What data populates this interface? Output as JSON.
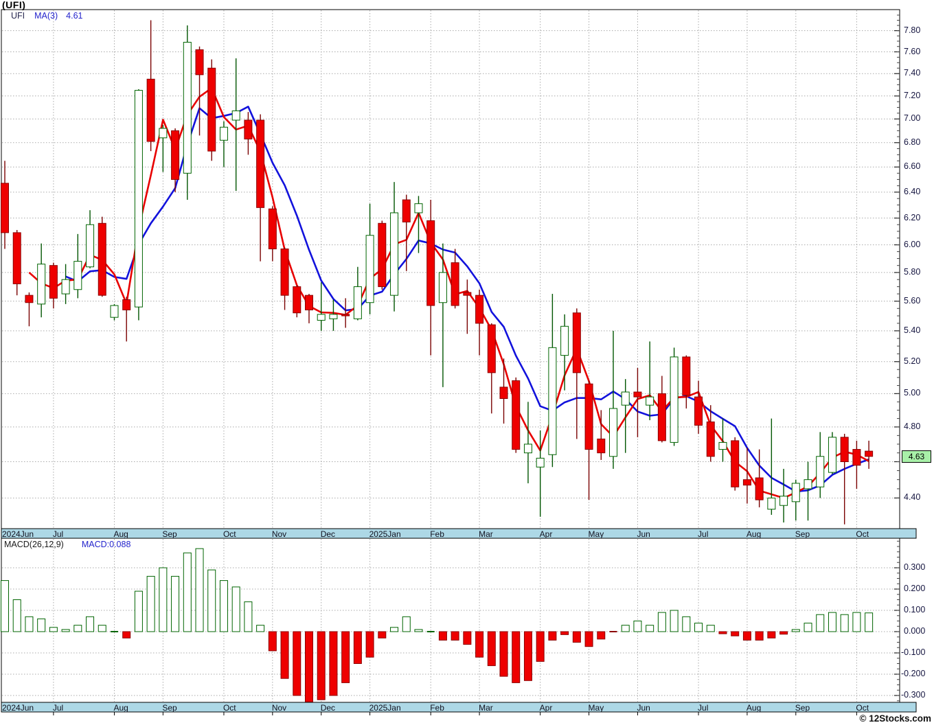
{
  "title": "(UFI)",
  "watermark": "© 12Stocks.com",
  "price_panel": {
    "legend": {
      "symbol": "UFI",
      "ma_label": "MA(3)",
      "ma_value": "4.61"
    },
    "last_price_label": "4.63",
    "axis_labels": [
      "7.80",
      "7.60",
      "7.40",
      "7.20",
      "7.00",
      "6.80",
      "6.60",
      "6.40",
      "6.20",
      "6.00",
      "5.80",
      "5.60",
      "5.40",
      "5.20",
      "5.00",
      "4.80",
      "4.40"
    ]
  },
  "macd_panel": {
    "legend": {
      "label": "MACD(26,12,9)",
      "value": "MACD:0.088"
    },
    "axis_labels": [
      "0.300",
      "0.200",
      "0.100",
      "0.000",
      "-0.100",
      "-0.200",
      "-0.300"
    ]
  },
  "months": [
    {
      "label": "2024Jun",
      "i": 0,
      "grid": false
    },
    {
      "label": "Jul",
      "i": 4,
      "grid": true
    },
    {
      "label": "Aug",
      "i": 9,
      "grid": true
    },
    {
      "label": "Sep",
      "i": 13,
      "grid": true
    },
    {
      "label": "Oct",
      "i": 18,
      "grid": true
    },
    {
      "label": "Nov",
      "i": 22,
      "grid": true
    },
    {
      "label": "Dec",
      "i": 26,
      "grid": true
    },
    {
      "label": "2025Jan",
      "i": 30,
      "grid": true
    },
    {
      "label": "Feb",
      "i": 35,
      "grid": true
    },
    {
      "label": "Mar",
      "i": 39,
      "grid": true
    },
    {
      "label": "Apr",
      "i": 44,
      "grid": true
    },
    {
      "label": "May",
      "i": 48,
      "grid": true
    },
    {
      "label": "Jun",
      "i": 52,
      "grid": true
    },
    {
      "label": "Jul",
      "i": 57,
      "grid": true
    },
    {
      "label": "Aug",
      "i": 61,
      "grid": true
    },
    {
      "label": "Sep",
      "i": 65,
      "grid": true
    },
    {
      "label": "Oct",
      "i": 70,
      "grid": true
    }
  ],
  "colors": {
    "up_border": "#006400",
    "up_fill": "#FFFFFF",
    "down_border": "#8B0000",
    "down_fill": "#EE0000",
    "wick_up": "#005500",
    "wick_down": "#7A0000",
    "ma_fast": "#E80000",
    "ma_slow": "#1212DC",
    "grid": "#A9A9A9",
    "band_bg": "#ADD8E6",
    "frame": "#000000",
    "last_price_bg": "#A8F0A8"
  },
  "chart_data": [
    {
      "type": "candlestick",
      "title": "(UFI)",
      "timeframe": "weekly",
      "x_range": "2024Jun to 2025Oct",
      "y_scale": "log",
      "y_ticks": [
        7.8,
        7.6,
        7.4,
        7.2,
        7.0,
        6.8,
        6.6,
        6.4,
        6.2,
        6.0,
        5.8,
        5.6,
        5.4,
        5.2,
        5.0,
        4.8,
        4.6,
        4.4
      ],
      "last_close": 4.63,
      "ma_lines": [
        {
          "name": "MA(3)",
          "window": 3,
          "color": "#E80000"
        },
        {
          "name": "MA-slow",
          "window": 6,
          "color": "#1212DC"
        }
      ],
      "ohlc": [
        [
          6.47,
          6.65,
          5.97,
          6.09
        ],
        [
          6.09,
          6.11,
          5.64,
          5.72
        ],
        [
          5.64,
          5.66,
          5.43,
          5.59
        ],
        [
          5.58,
          6.01,
          5.49,
          5.86
        ],
        [
          5.85,
          5.87,
          5.55,
          5.62
        ],
        [
          5.65,
          5.86,
          5.58,
          5.75
        ],
        [
          5.68,
          6.08,
          5.62,
          5.88
        ],
        [
          5.84,
          6.26,
          5.83,
          6.15
        ],
        [
          6.16,
          6.21,
          5.63,
          5.64
        ],
        [
          5.49,
          5.58,
          5.47,
          5.57
        ],
        [
          5.61,
          5.63,
          5.33,
          5.54
        ],
        [
          5.56,
          7.26,
          5.47,
          7.25
        ],
        [
          7.35,
          7.9,
          6.73,
          6.81
        ],
        [
          6.84,
          6.95,
          6.56,
          6.92
        ],
        [
          6.9,
          6.92,
          6.4,
          6.5
        ],
        [
          6.55,
          7.85,
          6.34,
          7.69
        ],
        [
          7.62,
          7.65,
          6.86,
          7.39
        ],
        [
          7.45,
          7.53,
          6.65,
          6.73
        ],
        [
          6.82,
          6.98,
          6.6,
          6.93
        ],
        [
          6.99,
          7.54,
          6.41,
          7.07
        ],
        [
          6.99,
          7.06,
          6.7,
          6.83
        ],
        [
          6.99,
          7.04,
          5.88,
          6.28
        ],
        [
          6.27,
          6.29,
          5.88,
          5.97
        ],
        [
          5.97,
          5.98,
          5.54,
          5.64
        ],
        [
          5.7,
          5.71,
          5.49,
          5.52
        ],
        [
          5.64,
          5.65,
          5.45,
          5.54
        ],
        [
          5.47,
          5.73,
          5.4,
          5.51
        ],
        [
          5.48,
          5.61,
          5.4,
          5.51
        ],
        [
          5.51,
          5.62,
          5.42,
          5.5
        ],
        [
          5.48,
          5.84,
          5.47,
          5.7
        ],
        [
          5.59,
          6.31,
          5.51,
          6.07
        ],
        [
          6.16,
          6.18,
          5.68,
          5.7
        ],
        [
          5.64,
          6.48,
          5.53,
          6.24
        ],
        [
          6.34,
          6.38,
          5.81,
          6.17
        ],
        [
          6.24,
          6.37,
          5.94,
          6.31
        ],
        [
          6.18,
          6.34,
          5.24,
          5.57
        ],
        [
          5.59,
          6.01,
          5.04,
          5.8
        ],
        [
          5.87,
          5.97,
          5.55,
          5.57
        ],
        [
          5.66,
          5.75,
          5.38,
          5.64
        ],
        [
          5.64,
          5.68,
          5.24,
          5.45
        ],
        [
          5.44,
          5.45,
          4.88,
          5.13
        ],
        [
          5.04,
          5.22,
          4.82,
          4.97
        ],
        [
          5.08,
          5.1,
          4.65,
          4.67
        ],
        [
          4.65,
          4.95,
          4.48,
          4.7
        ],
        [
          4.57,
          4.78,
          4.3,
          4.62
        ],
        [
          4.64,
          5.65,
          4.57,
          5.29
        ],
        [
          5.24,
          5.51,
          5.02,
          5.43
        ],
        [
          5.52,
          5.55,
          4.73,
          5.13
        ],
        [
          5.06,
          5.08,
          4.39,
          4.67
        ],
        [
          4.73,
          4.9,
          4.61,
          4.65
        ],
        [
          4.63,
          5.4,
          4.56,
          4.91
        ],
        [
          4.93,
          5.09,
          4.65,
          5.01
        ],
        [
          5.01,
          5.16,
          4.74,
          4.98
        ],
        [
          4.93,
          5.33,
          4.84,
          4.98
        ],
        [
          5.0,
          5.11,
          4.71,
          4.72
        ],
        [
          4.71,
          5.29,
          4.69,
          5.23
        ],
        [
          5.23,
          5.24,
          4.91,
          4.99
        ],
        [
          4.98,
          5.08,
          4.76,
          4.81
        ],
        [
          4.83,
          4.93,
          4.6,
          4.63
        ],
        [
          4.67,
          4.85,
          4.6,
          4.71
        ],
        [
          4.72,
          4.74,
          4.44,
          4.46
        ],
        [
          4.5,
          4.68,
          4.37,
          4.47
        ],
        [
          4.51,
          4.67,
          4.35,
          4.39
        ],
        [
          4.34,
          4.85,
          4.31,
          4.4
        ],
        [
          4.36,
          4.56,
          4.27,
          4.41
        ],
        [
          4.38,
          4.5,
          4.28,
          4.48
        ],
        [
          4.45,
          4.6,
          4.28,
          4.5
        ],
        [
          4.46,
          4.77,
          4.4,
          4.63
        ],
        [
          4.54,
          4.77,
          4.53,
          4.74
        ],
        [
          4.74,
          4.76,
          4.26,
          4.6
        ],
        [
          4.67,
          4.72,
          4.45,
          4.58
        ],
        [
          4.66,
          4.72,
          4.56,
          4.63
        ]
      ]
    },
    {
      "type": "bar",
      "title": "MACD(26,12,9)",
      "last_value": 0.088,
      "y_ticks": [
        0.3,
        0.2,
        0.1,
        0.0,
        -0.1,
        -0.2,
        -0.3
      ],
      "values": [
        0.24,
        0.15,
        0.07,
        0.06,
        0.02,
        0.01,
        0.03,
        0.07,
        0.03,
        0.004,
        -0.03,
        0.19,
        0.26,
        0.3,
        0.26,
        0.37,
        0.39,
        0.29,
        0.24,
        0.21,
        0.14,
        0.03,
        -0.09,
        -0.22,
        -0.3,
        -0.33,
        -0.32,
        -0.3,
        -0.24,
        -0.15,
        -0.12,
        -0.03,
        0.02,
        0.07,
        0.01,
        0.003,
        -0.04,
        -0.04,
        -0.06,
        -0.12,
        -0.16,
        -0.21,
        -0.24,
        -0.23,
        -0.14,
        -0.04,
        -0.014,
        -0.05,
        -0.07,
        -0.035,
        -0.004,
        0.03,
        0.05,
        0.03,
        0.09,
        0.1,
        0.07,
        0.04,
        0.03,
        -0.01,
        -0.02,
        -0.04,
        -0.04,
        -0.03,
        -0.012,
        0.01,
        0.04,
        0.08,
        0.09,
        0.08,
        0.09,
        0.088
      ]
    }
  ]
}
